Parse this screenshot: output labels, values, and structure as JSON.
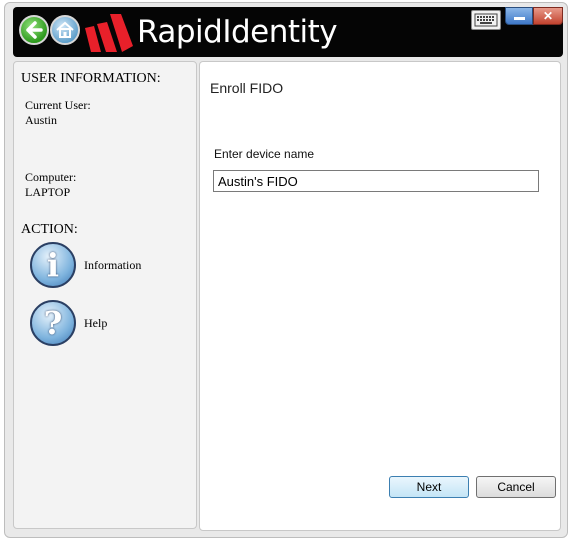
{
  "header": {
    "app_title": "RapidIdentity",
    "close_glyph": "✕",
    "icons": [
      "back-arrow-icon",
      "home-icon",
      "rapididentity-logo",
      "keyboard-icon",
      "minimize-icon",
      "close-icon"
    ]
  },
  "sidebar": {
    "user_heading": "USER INFORMATION:",
    "current_user_label": "Current User:",
    "current_user_value": "Austin",
    "computer_label": "Computer:",
    "computer_value": "LAPTOP",
    "action_heading": "ACTION:",
    "actions": [
      {
        "label": "Information",
        "icon": "info-icon",
        "glyph": "i"
      },
      {
        "label": "Help",
        "icon": "help-icon",
        "glyph": "?"
      }
    ]
  },
  "main": {
    "page_title": "Enroll FIDO",
    "device_name_label": "Enter device name",
    "device_name_value": "Austin's FIDO"
  },
  "buttons": {
    "next": "Next",
    "cancel": "Cancel"
  },
  "colors": {
    "titlebar": "#050505",
    "logo_red": "#e8202a",
    "window_bg": "#e9e9e9"
  }
}
